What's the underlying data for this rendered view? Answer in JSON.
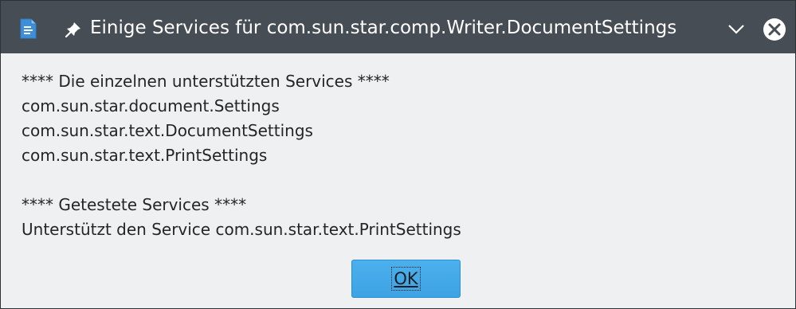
{
  "window": {
    "title": "Einige Services für com.sun.star.comp.Writer.DocumentSettings",
    "icons": {
      "app": "writer-document-icon",
      "pin": "pin-icon",
      "menu": "chevron-down-icon",
      "close": "close-circle-icon"
    },
    "colors": {
      "titlebar": "#474d55",
      "content_background": "#eff0f1",
      "button_accent": "#3da3e4"
    }
  },
  "message": {
    "lines": [
      "**** Die einzelnen unterstützten Services ****",
      "com.sun.star.document.Settings",
      "com.sun.star.text.DocumentSettings",
      "com.sun.star.text.PrintSettings",
      "",
      "**** Getestete Services ****",
      "Unterstützt den Service com.sun.star.text.PrintSettings"
    ]
  },
  "buttons": {
    "ok_label": "OK"
  }
}
